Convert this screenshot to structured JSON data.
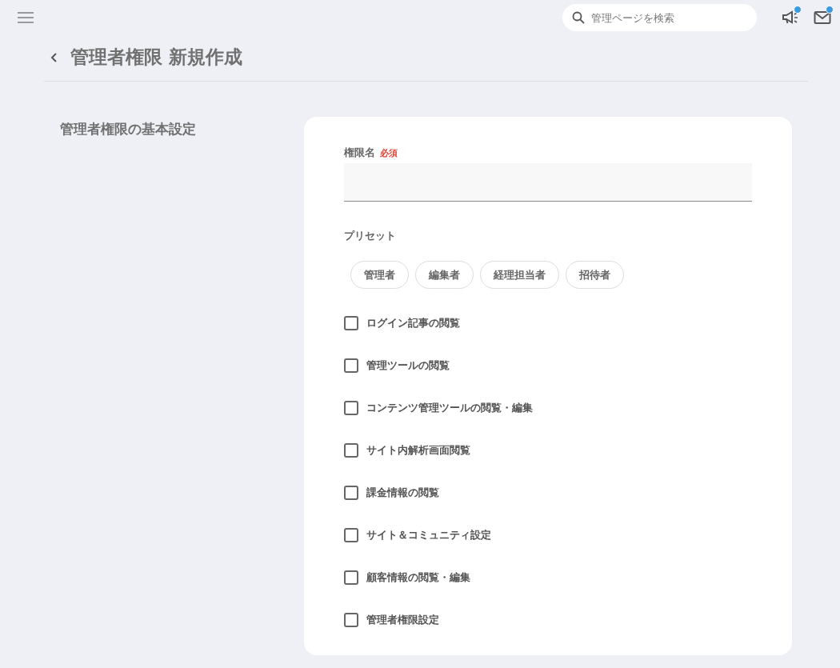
{
  "header": {
    "search": {
      "placeholder": "管理ページを検索"
    },
    "announcements_unread": true,
    "mail_unread": true
  },
  "page": {
    "title": "管理者権限 新規作成"
  },
  "section": {
    "title": "管理者権限の基本設定"
  },
  "form": {
    "name_field": {
      "label": "権限名",
      "required_badge": "必須"
    },
    "preset": {
      "label": "プリセット",
      "options": [
        "管理者",
        "編集者",
        "経理担当者",
        "招待者"
      ]
    },
    "permissions": [
      {
        "label": "ログイン記事の閲覧",
        "checked": false
      },
      {
        "label": "管理ツールの閲覧",
        "checked": false
      },
      {
        "label": "コンテンツ管理ツールの閲覧・編集",
        "checked": false
      },
      {
        "label": "サイト内解析画面閲覧",
        "checked": false
      },
      {
        "label": "課金情報の閲覧",
        "checked": false
      },
      {
        "label": "サイト＆コミュニティ設定",
        "checked": false
      },
      {
        "label": "顧客情報の閲覧・編集",
        "checked": false
      },
      {
        "label": "管理者権限設定",
        "checked": false
      }
    ]
  }
}
